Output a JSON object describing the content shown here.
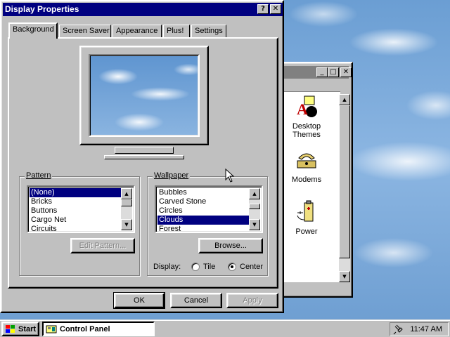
{
  "dialog": {
    "title": "Display Properties",
    "help_label": "?",
    "close_label": "✕",
    "tabs": [
      "Background",
      "Screen Saver",
      "Appearance",
      "Plus!",
      "Settings"
    ],
    "active_tab": "Background",
    "pattern": {
      "group_label": "Pattern",
      "items": [
        "(None)",
        "Bricks",
        "Buttons",
        "Cargo Net",
        "Circuits"
      ],
      "selected": "(None)",
      "edit_button": "Edit Pattern..."
    },
    "wallpaper": {
      "group_label": "Wallpaper",
      "items": [
        "Bubbles",
        "Carved Stone",
        "Circles",
        "Clouds",
        "Forest"
      ],
      "selected": "Clouds",
      "browse_button": "Browse...",
      "display_label": "Display:",
      "display_options": [
        "Tile",
        "Center"
      ],
      "display_selected": "Center"
    },
    "buttons": {
      "ok": "OK",
      "cancel": "Cancel",
      "apply": "Apply"
    }
  },
  "control_panel": {
    "items": [
      {
        "label": "Desktop Themes",
        "icon": "desktop-themes-icon"
      },
      {
        "label": "Modems",
        "icon": "modem-icon"
      },
      {
        "label": "Power",
        "icon": "power-icon"
      }
    ],
    "window_buttons": [
      "_",
      "□",
      "✕"
    ]
  },
  "taskbar": {
    "start_label": "Start",
    "task_label": "Control Panel",
    "clock": "11:47 AM"
  },
  "colors": {
    "title_active": "#000080",
    "title_inactive": "#808080",
    "face": "#c0c0c0",
    "selection": "#000080"
  }
}
